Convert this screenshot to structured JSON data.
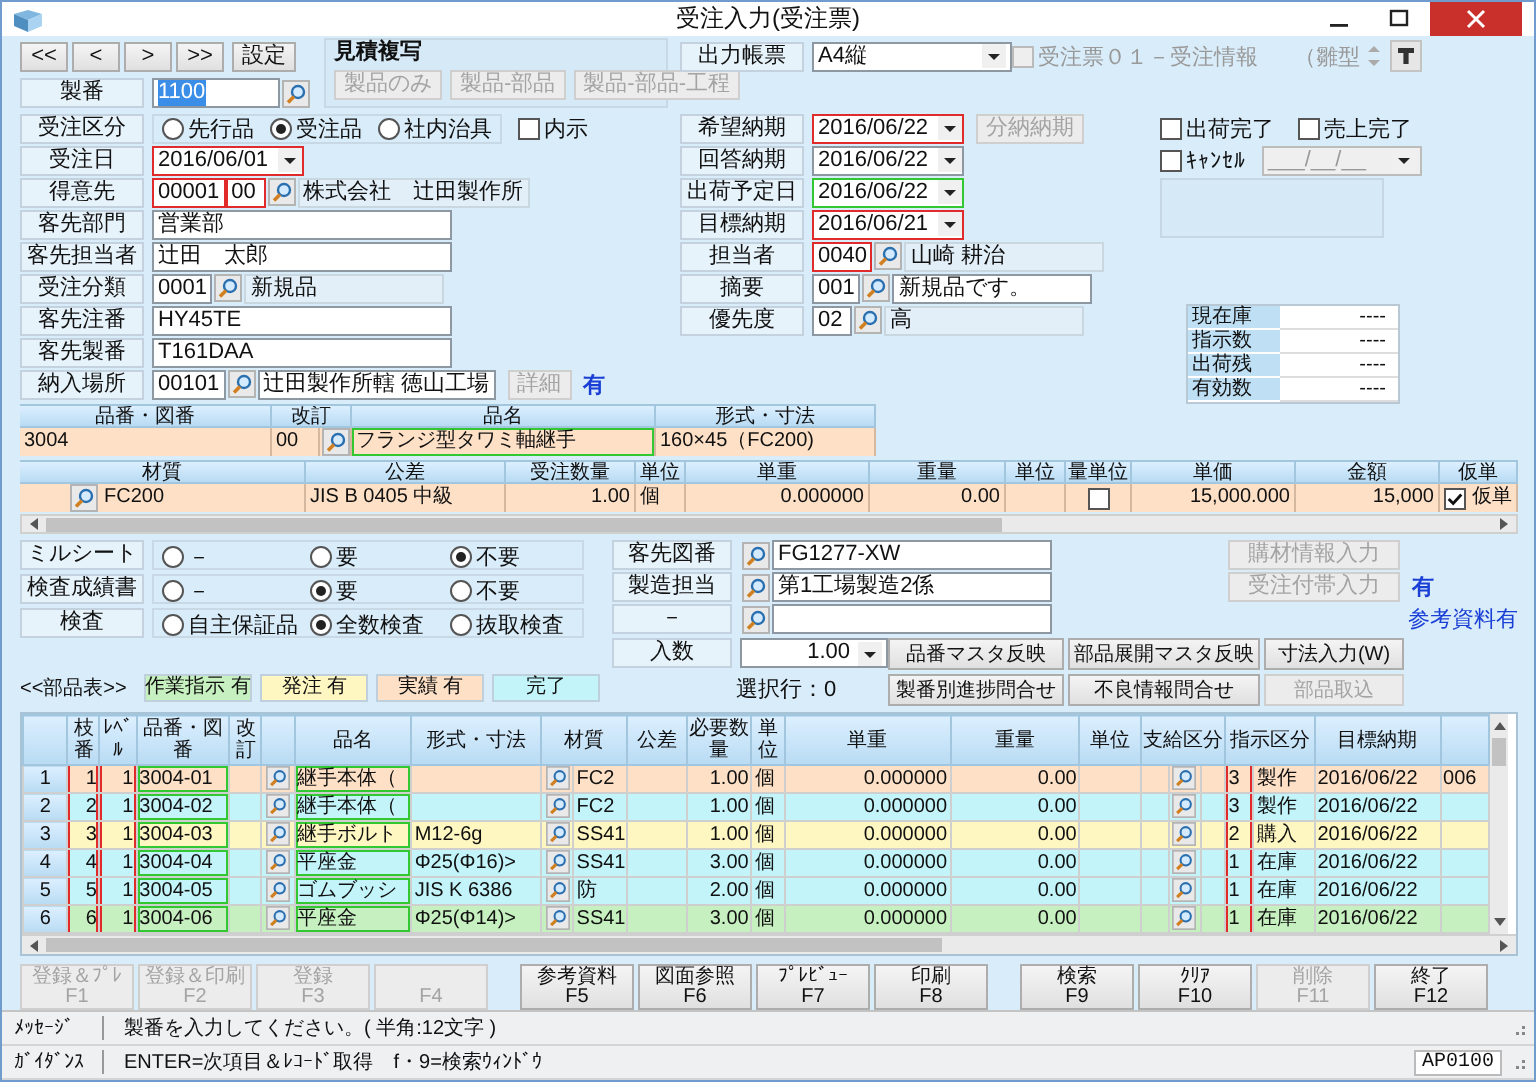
{
  "window": {
    "title": "受注入力(受注票)"
  },
  "nav_buttons": [
    "<<",
    "<",
    ">",
    ">>"
  ],
  "settings_button": "設定",
  "estimate_copy": {
    "title": "見積複写",
    "buttons": [
      {
        "label": "製品のみ",
        "disabled": true
      },
      {
        "label": "製品-部品",
        "disabled": true
      },
      {
        "label": "製品-部品-工程",
        "disabled": true
      }
    ]
  },
  "order_fields": [
    {
      "label": "製番",
      "kind": "search",
      "value": "1100",
      "highlighted": true
    },
    {
      "label": "受注区分",
      "kind": "radios",
      "options": [
        {
          "label": "先行品",
          "selected": false
        },
        {
          "label": "受注品",
          "selected": true
        },
        {
          "label": "社内治具",
          "selected": false
        }
      ],
      "checkbox": {
        "label": "内示",
        "checked": false
      }
    },
    {
      "label": "受注日",
      "kind": "date",
      "value": "2016/06/01",
      "required": true
    },
    {
      "label": "得意先",
      "kind": "lookup",
      "codes": [
        {
          "value": "00001",
          "required": true
        },
        {
          "value": "00",
          "required": true
        }
      ],
      "name": "株式会社　辻田製作所",
      "editable": false
    },
    {
      "label": "客先部門",
      "kind": "text",
      "value": "営業部"
    },
    {
      "label": "客先担当者",
      "kind": "text",
      "value": "辻田　太郎"
    },
    {
      "label": "受注分類",
      "kind": "lookup",
      "codes": [
        {
          "value": "0001",
          "required": false
        }
      ],
      "name": "新規品",
      "editable": false
    },
    {
      "label": "客先注番",
      "kind": "text",
      "value": "HY45TE"
    },
    {
      "label": "客先製番",
      "kind": "text",
      "value": "T161DAA"
    },
    {
      "label": "納入場所",
      "kind": "lookup",
      "codes": [
        {
          "value": "00101",
          "required": false
        }
      ],
      "name": "辻田製作所轄 徳山工場",
      "editable": true,
      "button": {
        "label": "詳細",
        "disabled": true
      },
      "note": "有"
    }
  ],
  "output_form": {
    "label": "出力帳票",
    "value": "A4縦",
    "template": {
      "label": "受注票０１－受注情報",
      "checked": false,
      "disabled": true
    },
    "template_type": "（雛型"
  },
  "schedule_fields": [
    {
      "label": "希望納期",
      "kind": "date",
      "value": "2016/06/22",
      "required": true,
      "confirmed": false,
      "button": {
        "label": "分納納期",
        "disabled": true
      }
    },
    {
      "label": "回答納期",
      "kind": "date",
      "value": "2016/06/22",
      "required": false,
      "confirmed": false
    },
    {
      "label": "出荷予定日",
      "kind": "date",
      "value": "2016/06/22",
      "required": false,
      "confirmed": true
    },
    {
      "label": "目標納期",
      "kind": "date",
      "value": "2016/06/21",
      "required": true,
      "confirmed": false
    },
    {
      "label": "担当者",
      "kind": "lookup",
      "codes": [
        {
          "value": "0040",
          "required": true
        }
      ],
      "name": "山崎 耕治",
      "editable": false
    },
    {
      "label": "摘要",
      "kind": "lookup",
      "codes": [
        {
          "value": "001",
          "required": false
        }
      ],
      "name": "新規品です。",
      "editable": true
    },
    {
      "label": "優先度",
      "kind": "lookup",
      "codes": [
        {
          "value": "02",
          "required": false
        }
      ],
      "name": "高",
      "editable": false
    }
  ],
  "status_checks": [
    {
      "label": "出荷完了",
      "checked": false
    },
    {
      "label": "売上完了",
      "checked": false
    }
  ],
  "cancel": {
    "label": "ｷｬﾝｾﾙ",
    "checked": false,
    "placeholder": "___/__/__"
  },
  "stock": [
    {
      "label": "現在庫",
      "value": "----"
    },
    {
      "label": "指示数",
      "value": "----"
    },
    {
      "label": "出荷残",
      "value": "----"
    },
    {
      "label": "有効数",
      "value": "----"
    }
  ],
  "product": {
    "headers": [
      "品番・図番",
      "改訂",
      "品名",
      "形式・寸法"
    ],
    "part_no": "3004",
    "revision": "00",
    "name": "フランジ型タワミ軸継手",
    "spec": "160×45（FC200)"
  },
  "order_line": {
    "headers": [
      "材質",
      "公差",
      "受注数量",
      "単位",
      "単重",
      "重量",
      "単位",
      "量単位",
      "単価",
      "金額",
      "仮単"
    ],
    "material": "FC200",
    "tolerance": "JIS B 0405 中級",
    "quantity": "1.00",
    "unit": "個",
    "unit_weight": "0.000000",
    "weight": "0.00",
    "unit_qty_checked": false,
    "price": "15,000.000",
    "amount": "15,000",
    "provisional": {
      "label": "仮単",
      "checked": true
    }
  },
  "inspection": [
    {
      "label": "ミルシート",
      "options": [
        {
          "label": "－",
          "selected": false
        },
        {
          "label": "要",
          "selected": false
        },
        {
          "label": "不要",
          "selected": true
        }
      ]
    },
    {
      "label": "検査成績書",
      "options": [
        {
          "label": "－",
          "selected": false
        },
        {
          "label": "要",
          "selected": true
        },
        {
          "label": "不要",
          "selected": false
        }
      ]
    },
    {
      "label": "検査",
      "options": [
        {
          "label": "自主保証品",
          "selected": false
        },
        {
          "label": "全数検査",
          "selected": true
        },
        {
          "label": "抜取検査",
          "selected": false
        }
      ]
    }
  ],
  "drawing_fields": [
    {
      "label": "客先図番",
      "value": "FG1277-XW"
    },
    {
      "label": "製造担当",
      "value": "第1工場製造2係"
    },
    {
      "label": "－"
    }
  ],
  "side_buttons": [
    {
      "label": "購材情報入力",
      "disabled": true
    },
    {
      "label": "受注付帯入力",
      "disabled": true,
      "note": "有"
    }
  ],
  "reference_link": "参考資料有",
  "quantity_per": {
    "label": "入数",
    "value": "1.00"
  },
  "selected_rows": "選択行：0",
  "actions": [
    {
      "label": "品番マスタ反映",
      "disabled": false
    },
    {
      "label": "部品展開マスタ反映",
      "disabled": false
    },
    {
      "label": "寸法入力(W)",
      "disabled": false
    },
    {
      "label": "製番別進捗問合せ",
      "disabled": false
    },
    {
      "label": "不良情報問合せ",
      "disabled": false
    },
    {
      "label": "部品取込",
      "disabled": true
    }
  ],
  "legend": {
    "title": "<<部品表>>",
    "items": [
      {
        "label": "作業指示 有",
        "color": "#c6f0bf"
      },
      {
        "label": "発注 有",
        "color": "#fff7c2"
      },
      {
        "label": "実績 有",
        "color": "#fde0c6"
      },
      {
        "label": "完了",
        "color": "#c2f4fa"
      }
    ]
  },
  "parts_table": {
    "headers": {
      "branch": "枝番",
      "level": "ﾚﾍﾞﾙ",
      "part_no": "品番・図番",
      "revision": "改訂",
      "name": "品名",
      "spec": "形式・寸法",
      "material": "材質",
      "tolerance": "公差",
      "required_qty": "必要数量",
      "unit": "単位",
      "unit_weight": "単重",
      "weight": "重量",
      "unit2": "単位",
      "supply": "支給区分",
      "instruction": "指示区分",
      "target_date": "目標納期"
    },
    "rows": [
      {
        "no": "1",
        "branch": "1",
        "level": "1",
        "part_no": "3004-01",
        "name": "継手本体（",
        "material": "FC2",
        "required_qty": "1.00",
        "unit": "個",
        "unit_weight": "0.000000",
        "weight": "0.00",
        "instruction_code": "3",
        "instruction": "製作",
        "target_date": "2016/06/22",
        "extra": "006",
        "color": "#fde0c6"
      },
      {
        "no": "2",
        "branch": "2",
        "level": "1",
        "part_no": "3004-02",
        "name": "継手本体（",
        "material": "FC2",
        "required_qty": "1.00",
        "unit": "個",
        "unit_weight": "0.000000",
        "weight": "0.00",
        "instruction_code": "3",
        "instruction": "製作",
        "target_date": "2016/06/22",
        "color": "#c2f4fa"
      },
      {
        "no": "3",
        "branch": "3",
        "level": "1",
        "part_no": "3004-03",
        "name": "継手ボルト",
        "spec": "M12-6g",
        "material": "SS41",
        "required_qty": "1.00",
        "unit": "個",
        "unit_weight": "0.000000",
        "weight": "0.00",
        "instruction_code": "2",
        "instruction": "購入",
        "target_date": "2016/06/22",
        "color": "#fff7c2"
      },
      {
        "no": "4",
        "branch": "4",
        "level": "1",
        "part_no": "3004-04",
        "name": "平座金",
        "spec": "Φ25(Φ16)>",
        "material": "SS41",
        "required_qty": "3.00",
        "unit": "個",
        "unit_weight": "0.000000",
        "weight": "0.00",
        "instruction_code": "1",
        "instruction": "在庫",
        "target_date": "2016/06/22",
        "color": "#c2f4fa"
      },
      {
        "no": "5",
        "branch": "5",
        "level": "1",
        "part_no": "3004-05",
        "name": "ゴムブッシ",
        "spec": "JIS K 6386",
        "material": "防",
        "required_qty": "2.00",
        "unit": "個",
        "unit_weight": "0.000000",
        "weight": "0.00",
        "instruction_code": "1",
        "instruction": "在庫",
        "target_date": "2016/06/22",
        "color": "#c2f4fa"
      },
      {
        "no": "6",
        "branch": "6",
        "level": "1",
        "part_no": "3004-06",
        "name": "平座金",
        "spec": "Φ25(Φ14)>",
        "material": "SS41",
        "required_qty": "3.00",
        "unit": "個",
        "unit_weight": "0.000000",
        "weight": "0.00",
        "instruction_code": "1",
        "instruction": "在庫",
        "target_date": "2016/06/22",
        "color": "#c6f0bf"
      }
    ]
  },
  "function_key_groups": [
    [
      {
        "label": "登録＆ﾌﾟﾚ",
        "key": "F1",
        "disabled": true
      },
      {
        "label": "登録＆印刷",
        "key": "F2",
        "disabled": true
      },
      {
        "label": "登録",
        "key": "F3",
        "disabled": true
      },
      {
        "key": "F4",
        "disabled": true
      }
    ],
    [
      {
        "label": "参考資料",
        "key": "F5",
        "disabled": false
      },
      {
        "label": "図面参照",
        "key": "F6",
        "disabled": false
      },
      {
        "label": "ﾌﾟﾚﾋﾞｭｰ",
        "key": "F7",
        "disabled": false
      },
      {
        "label": "印刷",
        "key": "F8",
        "disabled": false
      }
    ],
    [
      {
        "label": "検索",
        "key": "F9",
        "disabled": false
      },
      {
        "label": "ｸﾘｱ",
        "key": "F10",
        "disabled": false
      },
      {
        "label": "削除",
        "key": "F11",
        "disabled": true
      },
      {
        "label": "終了",
        "key": "F12",
        "disabled": false
      }
    ]
  ],
  "status_bar": {
    "message_label": "ﾒｯｾｰｼﾞ",
    "message": "製番を入力してください。( 半角:12文字 )",
    "guidance_label": "ｶﾞｲﾀﾞﾝｽ",
    "guidance": "ENTER=次項目＆ﾚｺｰﾄﾞ取得　f・9=検索ｳｨﾝﾄﾞｳ",
    "screen_id": "AP0100"
  }
}
